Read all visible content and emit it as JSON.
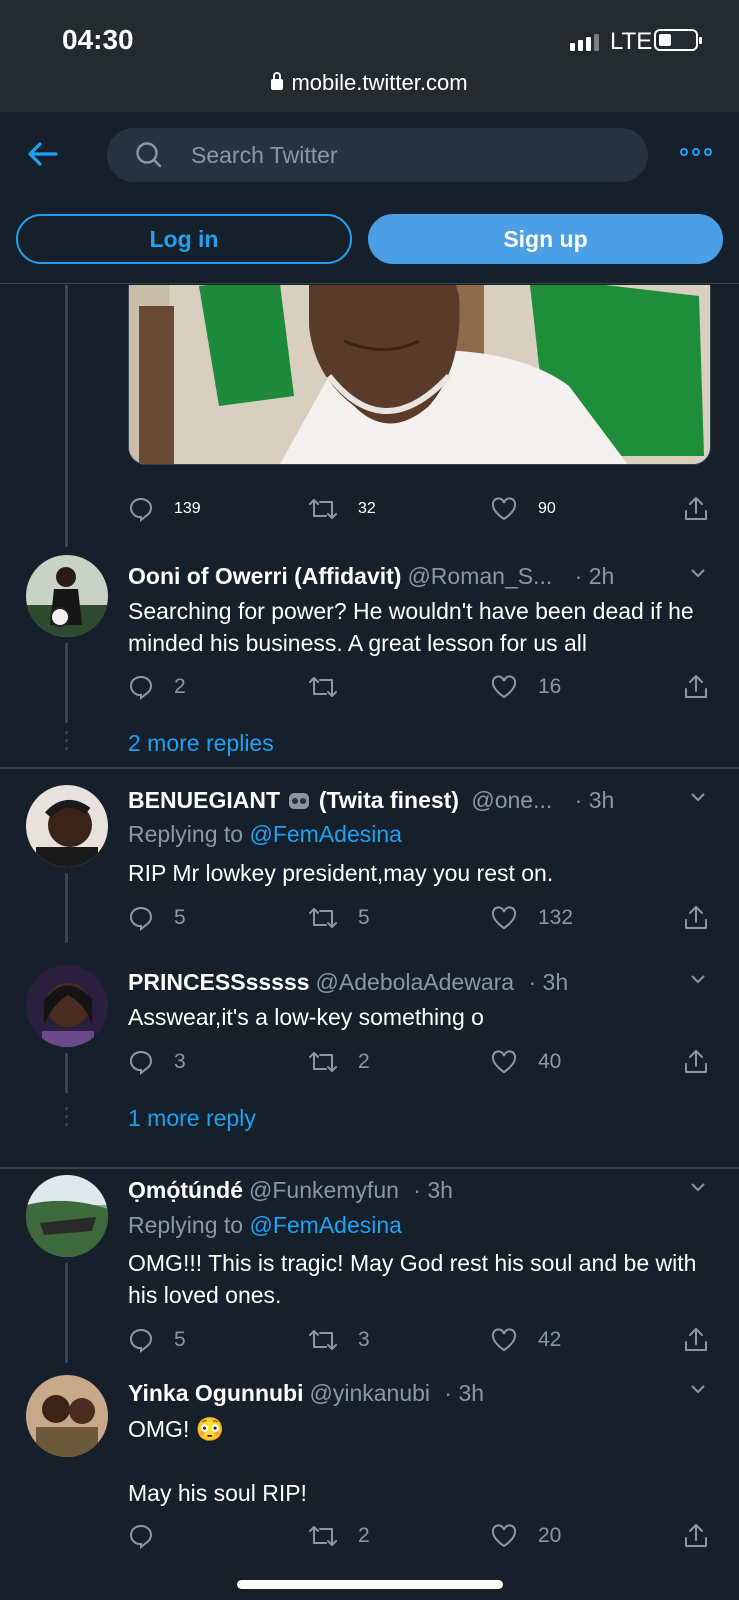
{
  "status": {
    "time": "04:30",
    "network": "LTE",
    "url": "mobile.twitter.com"
  },
  "nav": {
    "search_placeholder": "Search Twitter",
    "login": "Log in",
    "signup": "Sign up"
  },
  "top_tweet_actions": {
    "replies": "139",
    "retweets": "32",
    "likes": "90"
  },
  "tweets": [
    {
      "name": "Ooni of Owerri (Affidavit)",
      "handle": "@Roman_S...",
      "time": "· 2h",
      "replying": "",
      "body": "Searching for power? He wouldn't have been dead if he minded his business. A great lesson for us all",
      "replies": "2",
      "retweets": "",
      "likes": "16"
    },
    {
      "name": "BENUEGIANT",
      "name_suffix": "(Twita finest)",
      "handle": "@one...",
      "time": "· 3h",
      "replying_prefix": "Replying to ",
      "replying": "@FemAdesina",
      "body": "RIP Mr lowkey president,may you rest on.",
      "replies": "5",
      "retweets": "5",
      "likes": "132"
    },
    {
      "name": "PRINCESSsssss",
      "handle": "@AdebolaAdewara",
      "time": "· 3h",
      "body": "Asswear,it's a low-key something o",
      "replies": "3",
      "retweets": "2",
      "likes": "40"
    },
    {
      "name": "Ọmọ́túndé",
      "handle": "@Funkemyfun",
      "time": "· 3h",
      "replying_prefix": "Replying to ",
      "replying": "@FemAdesina",
      "body": "OMG!!! This is tragic! May God rest his soul and be with his loved ones.",
      "replies": "5",
      "retweets": "3",
      "likes": "42"
    },
    {
      "name": "Yinka Ogunnubi",
      "handle": "@yinkanubi",
      "time": "· 3h",
      "body_line1": "OMG! 😳",
      "body_line2": "May his soul RIP!",
      "replies": "",
      "retweets": "2",
      "likes": "20"
    }
  ],
  "more_replies": [
    "2 more replies",
    "1 more reply"
  ],
  "colors": {
    "bg": "#15202b",
    "accent": "#1da1f2",
    "muted": "#8899a6",
    "border": "#38444d"
  }
}
